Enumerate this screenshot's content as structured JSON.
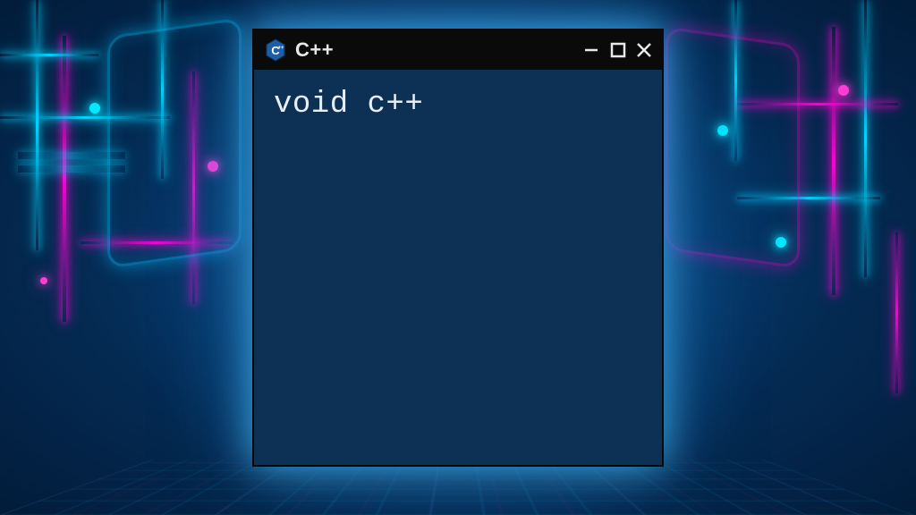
{
  "window": {
    "title": "C++",
    "icon_name": "cpp-icon",
    "controls": {
      "minimize": "minimize",
      "maximize": "maximize",
      "close": "close"
    }
  },
  "editor": {
    "content": "void c++"
  },
  "colors": {
    "window_bg": "#0d3055",
    "titlebar_bg": "#0a0a0a",
    "text": "#e8eef5",
    "glow_cyan": "#00d4ff",
    "glow_magenta": "#ff00d4"
  }
}
